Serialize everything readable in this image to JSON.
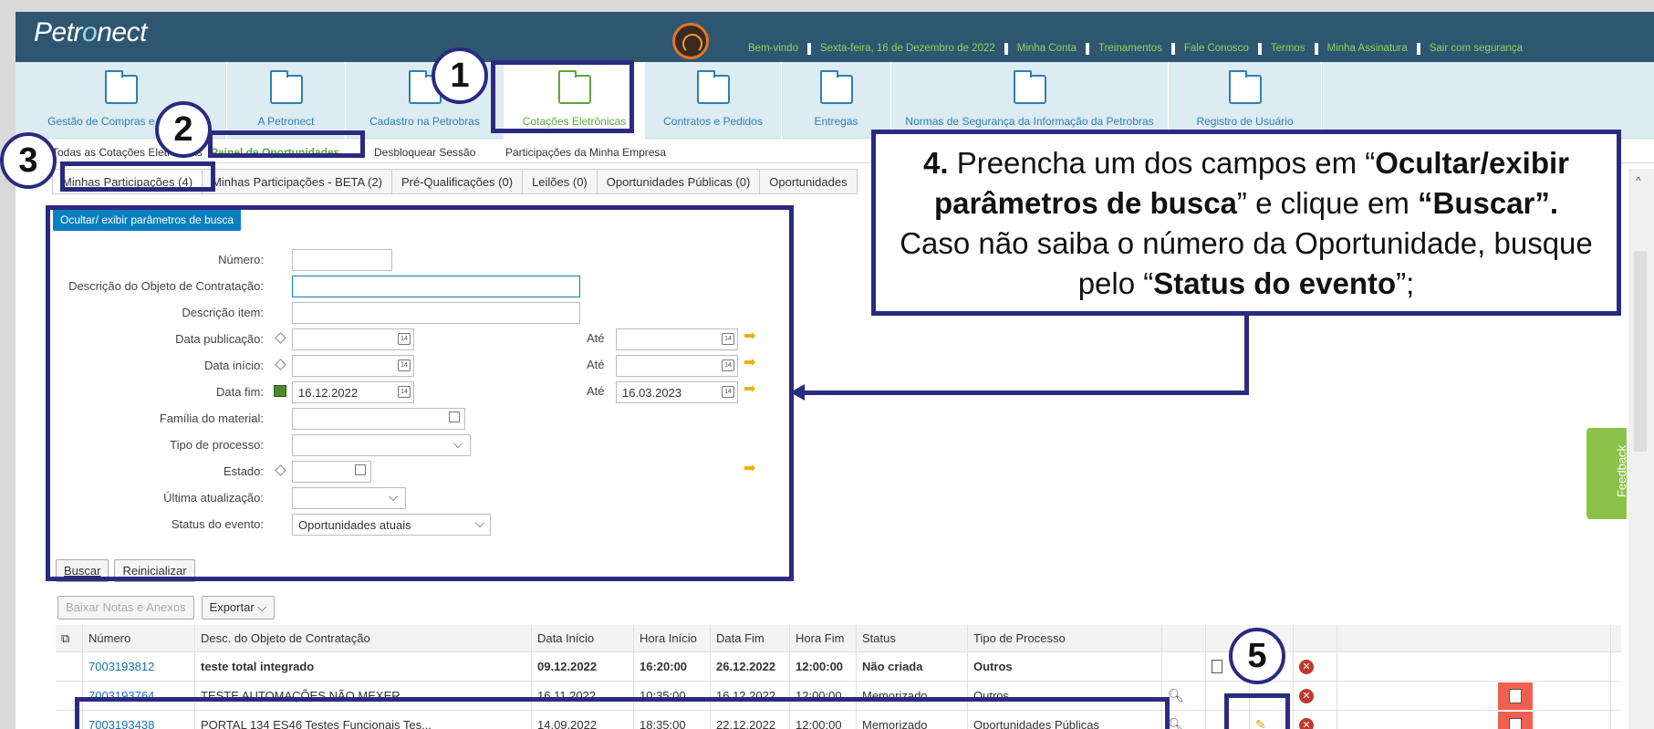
{
  "logo": {
    "text_pre": "Petr",
    "text_o": "o",
    "text_post": "nect"
  },
  "top_links": [
    "Bem-vindo",
    "Sexta-feira, 16 de Dezembro de 2022",
    "Minha Conta",
    "Treinamentos",
    "Fale Conosco",
    "Termos",
    "Minha Assinatura",
    "Sair com segurança"
  ],
  "nav": [
    {
      "label": "Gestão de Compras e Vendas"
    },
    {
      "label": "A Petronect"
    },
    {
      "label": "Cadastro na Petrobras"
    },
    {
      "label": "Cotações Eletrônicas"
    },
    {
      "label": "Contratos e Pedidos"
    },
    {
      "label": "Entregas"
    },
    {
      "label": "Normas de Segurança da Informação da Petrobras"
    },
    {
      "label": "Registro de Usuário"
    }
  ],
  "subnav": [
    "Todas as Cotações Eletrônicas",
    "Painel de Oportunidades",
    "Desbloquear Sessão",
    "Participações da Minha Empresa"
  ],
  "tabs": [
    "Minhas Participações (4)",
    "Minhas Participações - BETA (2)",
    "Pré-Qualificações (0)",
    "Leilões (0)",
    "Oportunidades Públicas (0)",
    "Oportunidades"
  ],
  "search_toggle": "Ocultar/ exibir parâmetros de busca",
  "form": {
    "numero": "Número:",
    "descricao_objeto": "Descrição do Objeto de Contratação:",
    "descricao_item": "Descrição item:",
    "data_publicacao": "Data publicação:",
    "data_inicio": "Data início:",
    "data_fim": "Data fim:",
    "ate": "Até",
    "data_fim_value": "16.12.2022",
    "data_fim_ate_value": "16.03.2023",
    "familia": "Família do material:",
    "tipo_processo": "Tipo de processo:",
    "estado": "Estado:",
    "ultima_atualizacao": "Última atualização:",
    "status_evento": "Status do evento:",
    "status_evento_value": "Oportunidades atuais"
  },
  "buttons": {
    "buscar": "Buscar",
    "reiniciar": "Reinicializar",
    "baixar": "Baixar Notas e Anexos",
    "exportar": "Exportar"
  },
  "grid": {
    "headers": [
      "Número",
      "Desc. do Objeto de Contratação",
      "Data Início",
      "Hora Início",
      "Data Fim",
      "Hora Fim",
      "Status",
      "Tipo de Processo"
    ],
    "rows": [
      [
        "7003193812",
        "teste total integrado",
        "09.12.2022",
        "16:20:00",
        "26.12.2022",
        "12:00:00",
        "Não criada",
        "Outros"
      ],
      [
        "7003193764",
        "TESTE AUTOMAÇÕES NÃO MEXER",
        "16.11.2022",
        "10:35:00",
        "16.12.2022",
        "12:00:00",
        "Memorizado",
        "Outros"
      ],
      [
        "7003193438",
        "PORTAL 134 ES46 Testes Funcionais Tes...",
        "14.09.2022",
        "18:35:00",
        "22.12.2022",
        "12:00:00",
        "Memorizado",
        "Oportunidades Públicas"
      ]
    ]
  },
  "feedback": "Feedback",
  "annotations": {
    "n1": "1",
    "n2": "2",
    "n3": "3",
    "n5": "5",
    "callout_a": "4.",
    "callout_b": " Preencha um dos campos em “",
    "callout_c": "Ocultar/exibir parâmetros de busca",
    "callout_d": "” e clique em ",
    "callout_e": "“Buscar”.",
    "callout_f": "Caso não saiba o número da Oportunidade, busque pelo “",
    "callout_g": "Status do evento",
    "callout_h": "”;"
  },
  "colors": {
    "annotation": "#2b2a80",
    "topbar": "#2e5670",
    "nav_bg": "#dcecf2",
    "active_green": "#5aa83a",
    "link_blue": "#1a6fb0"
  }
}
